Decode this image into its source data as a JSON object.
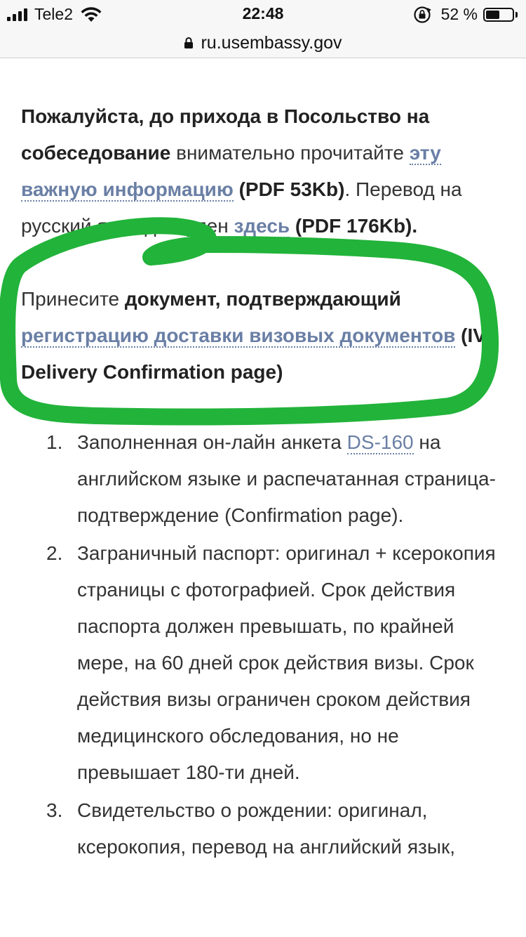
{
  "status_bar": {
    "carrier": "Tele2",
    "time": "22:48",
    "battery_percent": "52 %",
    "battery_level": 0.52
  },
  "url_bar": {
    "domain": "ru.usembassy.gov"
  },
  "intro": {
    "bold_lead": "Пожалуйста, до прихода в Посольство на собеседование",
    "text_1": " внимательно прочитайте ",
    "link_1": "эту важную информацию",
    "pdf_1": " (PDF 53Kb)",
    "text_2": ". Перевод на русский язык доступен ",
    "link_2": "здесь",
    "pdf_2": " (PDF 176Kb)."
  },
  "notice": {
    "text_1": "Принесите ",
    "bold_1": "документ, подтверждающий",
    "link": "регистрацию доставки визовых документов",
    "bold_2": " (IV Delivery Confirmation page)"
  },
  "requirements": [
    {
      "text_1": "Заполненная он-лайн анкета ",
      "link": "DS-160",
      "text_2": " на английском языке и распечатанная страница-подтверждение (Confirmation page)."
    },
    {
      "text_1": "Заграничный паспорт: оригинал + ксерокопия страницы с фотографией. Срок действия паспорта должен превышать, по крайней мере, на 60 дней срок действия визы. Срок действия визы ограничен сроком действия медицинского обследования, но не превышает 180-ти дней."
    },
    {
      "text_1": "Свидетельство о рождении: оригинал, ксерокопия, перевод на английский язык,"
    }
  ],
  "colors": {
    "link": "#6a7fa5",
    "highlight": "#22b33a"
  }
}
